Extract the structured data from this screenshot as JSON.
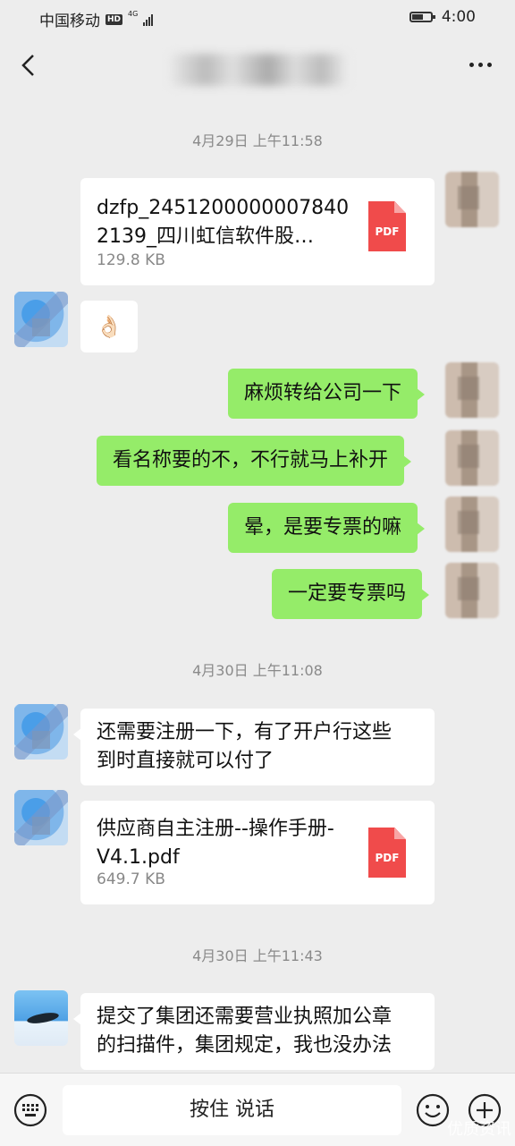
{
  "status": {
    "carrier": "中国移动",
    "hd": "HD",
    "network": "4G",
    "time": "4:00"
  },
  "nav": {
    "back_icon": "chevron-left-icon",
    "more_icon": "more-dots-icon"
  },
  "messages": {
    "ts1": "4月29日 上午11:58",
    "file1": {
      "name": "dzfp_24512000000078402139_四川虹信软件股…",
      "size": "129.8 KB",
      "icon_label": "PDF"
    },
    "emoji1": "👌🏻",
    "m1": "麻烦转给公司一下",
    "m2": "看名称要的不，不行就马上补开",
    "m3": "晕，是要专票的嘛",
    "m4": "一定要专票吗",
    "ts2": "4月30日 上午11:08",
    "m5_line1": "还需要注册一下，有了开户行这些",
    "m5_line2": "到时直接就可以付了",
    "file2": {
      "name": "供应商自主注册--操作手册-V4.1.pdf",
      "size": "649.7 KB",
      "icon_label": "PDF"
    },
    "ts3": "4月30日 上午11:43",
    "m6_line1": "提交了集团还需要营业执照加公章",
    "m6_line2": "的扫描件，集团规定，我也没办法"
  },
  "input_bar": {
    "hold_to_talk": "按住 说话",
    "keyboard_icon": "keyboard-icon",
    "emoji_icon": "smiley-icon",
    "plus_icon": "plus-circle-icon"
  },
  "watermark": "优质资讯"
}
